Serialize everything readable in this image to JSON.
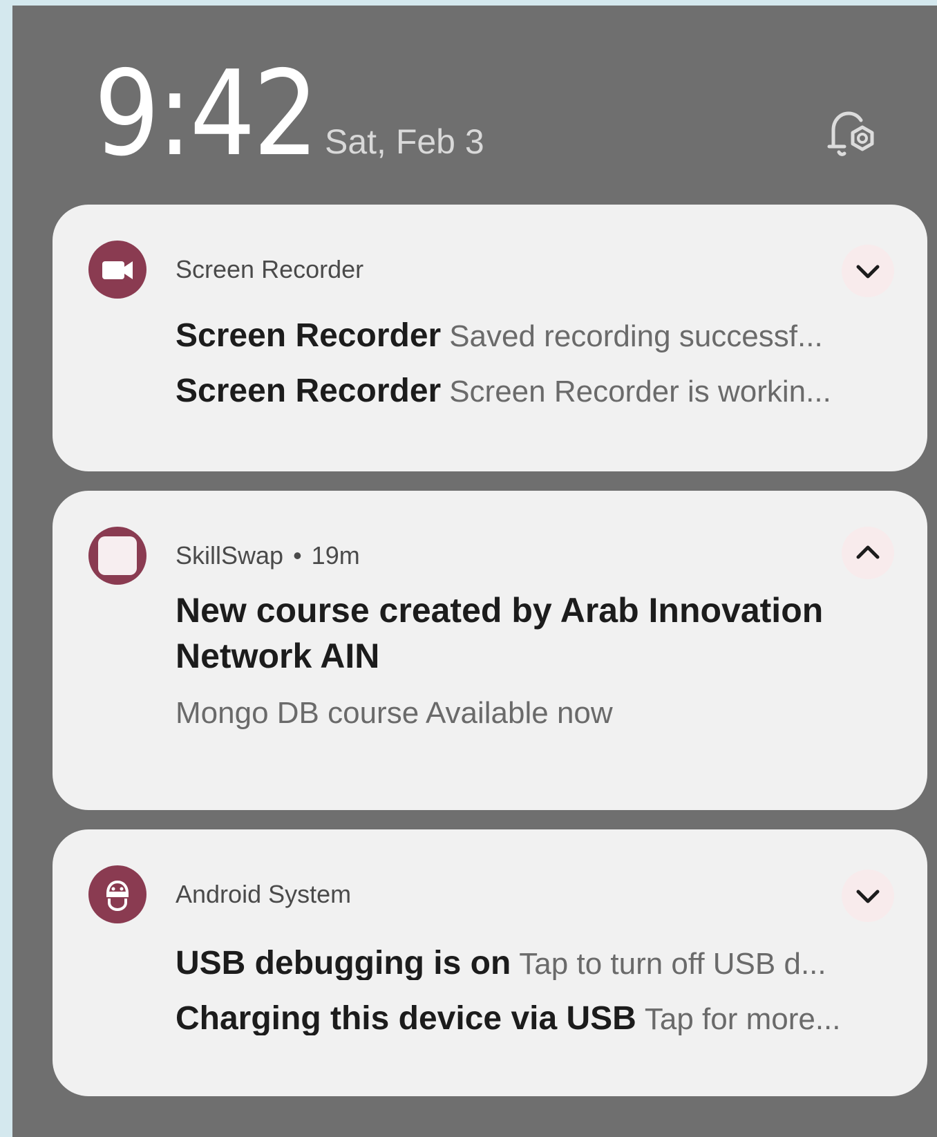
{
  "status": {
    "time": "9:42",
    "date": "Sat, Feb 3",
    "settings_icon": "notification-settings-icon"
  },
  "notifications": [
    {
      "app": "Screen Recorder",
      "icon": "video-camera-icon",
      "expand_icon": "chevron-down-icon",
      "items": [
        {
          "title": "Screen Recorder",
          "text": "Saved recording successf..."
        },
        {
          "title": "Screen Recorder",
          "text": "Screen Recorder is workin..."
        }
      ]
    },
    {
      "app": "SkillSwap",
      "time": "19m",
      "separator": "•",
      "icon": "app-square-icon",
      "expand_icon": "chevron-up-icon",
      "title": "New course created by Arab Innovation Network AIN",
      "text": "Mongo DB course Available now"
    },
    {
      "app": "Android System",
      "icon": "android-robot-icon",
      "expand_icon": "chevron-down-icon",
      "items": [
        {
          "title": "USB debugging is on",
          "text": "Tap to turn off USB d..."
        },
        {
          "title": "Charging this device via USB",
          "text": "Tap for more..."
        }
      ]
    }
  ],
  "colors": {
    "accent": "#8a3b51",
    "shade": "#6f6f6f",
    "card": "#f1f1f1"
  }
}
